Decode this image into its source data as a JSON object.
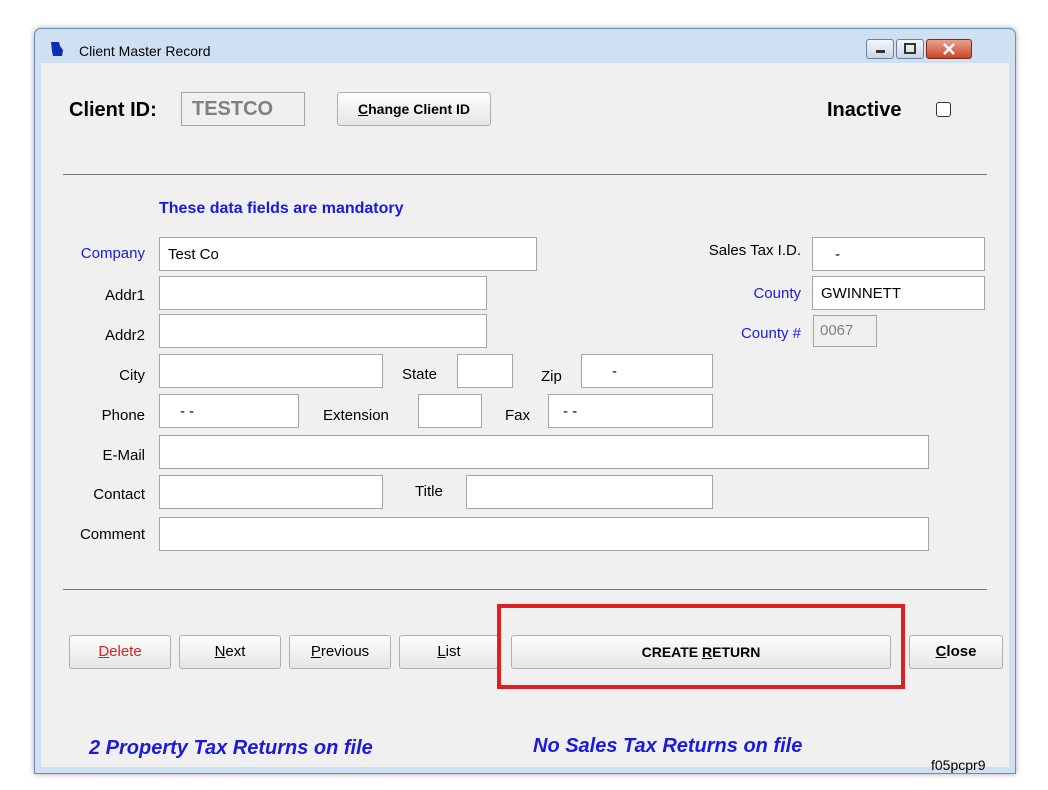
{
  "window": {
    "title": "Client Master Record"
  },
  "header": {
    "client_id_label": "Client ID:",
    "client_id_value": "TESTCO",
    "change_client_id_label": "Change Client ID",
    "inactive_label": "Inactive"
  },
  "mandatory_note": "These data fields are mandatory",
  "form": {
    "company_label": "Company",
    "company_value": "Test Co",
    "addr1_label": "Addr1",
    "addr1_value": "",
    "addr2_label": "Addr2",
    "addr2_value": "",
    "city_label": "City",
    "city_value": "",
    "state_label": "State",
    "state_value": "",
    "zip_label": "Zip",
    "zip_value": "-",
    "phone_label": "Phone",
    "phone_value": "-  -",
    "extension_label": "Extension",
    "extension_value": "",
    "fax_label": "Fax",
    "fax_value": "-  -",
    "email_label": "E-Mail",
    "email_value": "",
    "contact_label": "Contact",
    "contact_value": "",
    "title_label": "Title",
    "title_value": "",
    "comment_label": "Comment",
    "comment_value": "",
    "sales_tax_id_label": "Sales Tax I.D.",
    "sales_tax_id_value": "-",
    "county_label": "County",
    "county_value": "GWINNETT",
    "county_num_label": "County #",
    "county_num_value": "0067"
  },
  "buttons": {
    "delete": {
      "key": "D",
      "rest": "elete"
    },
    "next": {
      "key": "N",
      "rest": "ext"
    },
    "previous": {
      "key": "P",
      "rest": "revious"
    },
    "list": {
      "key": "L",
      "rest": "ist"
    },
    "create_return": {
      "pre": "CREATE ",
      "key": "R",
      "rest": "ETURN"
    },
    "close": {
      "key": "C",
      "rest": "lose"
    }
  },
  "status": {
    "property_tax": "2 Property Tax Returns on file",
    "sales_tax": "No Sales Tax Returns on file",
    "form_code": "f05pcpr9"
  },
  "colors": {
    "highlight": "#e02020",
    "mandatory": "#1a1adf",
    "delete_text": "#e02020"
  }
}
